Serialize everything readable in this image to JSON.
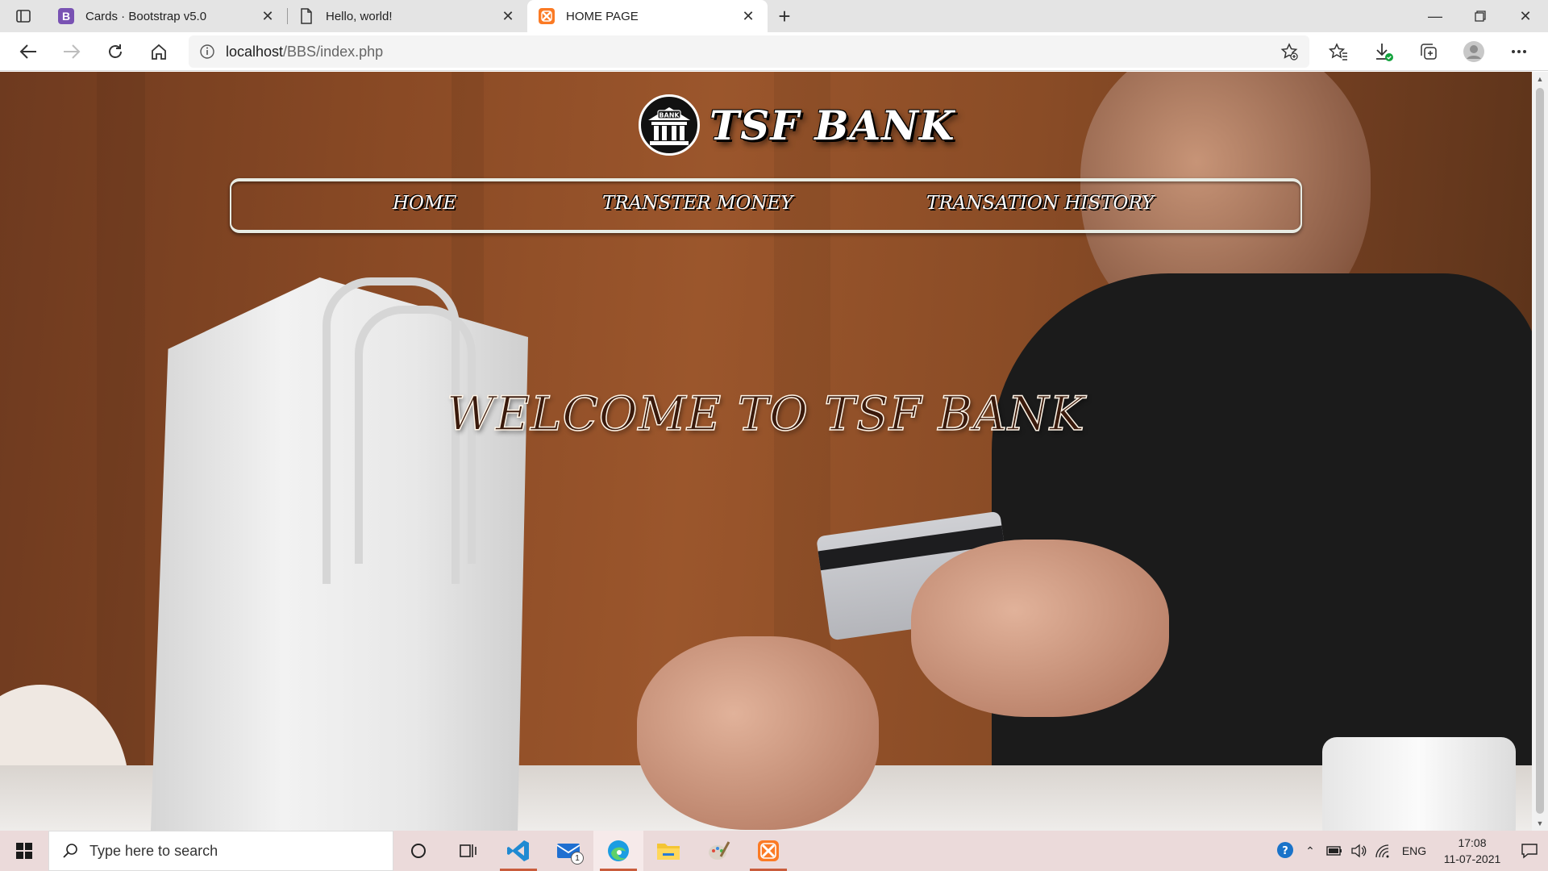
{
  "browser": {
    "tabs": [
      {
        "title": "Cards · Bootstrap v5.0",
        "icon": "bootstrap-icon",
        "color": "#7952b3"
      },
      {
        "title": "Hello, world!",
        "icon": "page-icon"
      },
      {
        "title": "HOME PAGE",
        "icon": "xampp-icon",
        "color": "#fb7a24"
      }
    ],
    "address": {
      "host": "localhost",
      "path": "/BBS/index.php"
    }
  },
  "page": {
    "brand": "TSF BANK",
    "logo_text": "BANK",
    "nav": [
      "HOME",
      "TRANSTER MONEY",
      "TRANSATION HISTORY"
    ],
    "welcome": "WELCOME TO TSF BANK"
  },
  "taskbar": {
    "search_placeholder": "Type here to search",
    "mail_badge": "1",
    "language": "ENG",
    "time": "17:08",
    "date": "11-07-2021"
  }
}
